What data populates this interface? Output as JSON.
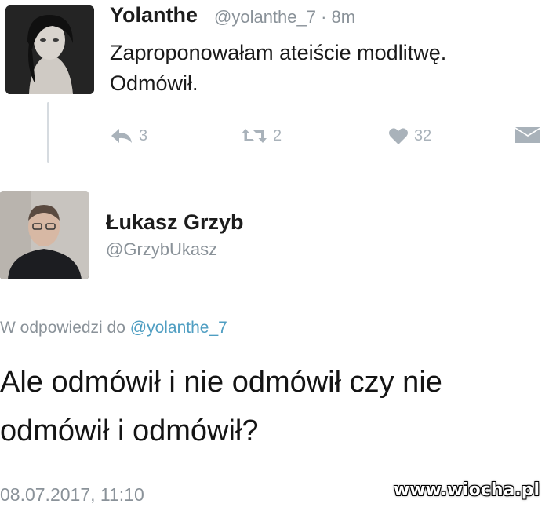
{
  "tweet1": {
    "author_name": "Yolanthe",
    "handle_time": "@yolanthe_7 · 8m",
    "text_lines": [
      "Zaproponowałam ateiście modlitwę.",
      "Odmówił."
    ],
    "actions": {
      "reply_count": "3",
      "retweet_count": "2",
      "like_count": "32"
    }
  },
  "tweet2": {
    "author_name": "Łukasz Grzyb",
    "handle": "@GrzybUkasz",
    "reply_prefix": "W odpowiedzi do ",
    "reply_mention": "@yolanthe_7",
    "text_lines": [
      "Ale odmówił i nie odmówił czy nie",
      "odmówił i odmówił?"
    ],
    "timestamp": "08.07.2017, 11:10"
  },
  "watermark": "www.wiocha.pl",
  "colors": {
    "muted": "#8a9299",
    "icon": "#a9b2ba",
    "mention": "#4f9ec2",
    "text": "#1a1a1a"
  },
  "icons": [
    "reply-icon",
    "retweet-icon",
    "heart-icon",
    "message-icon"
  ]
}
